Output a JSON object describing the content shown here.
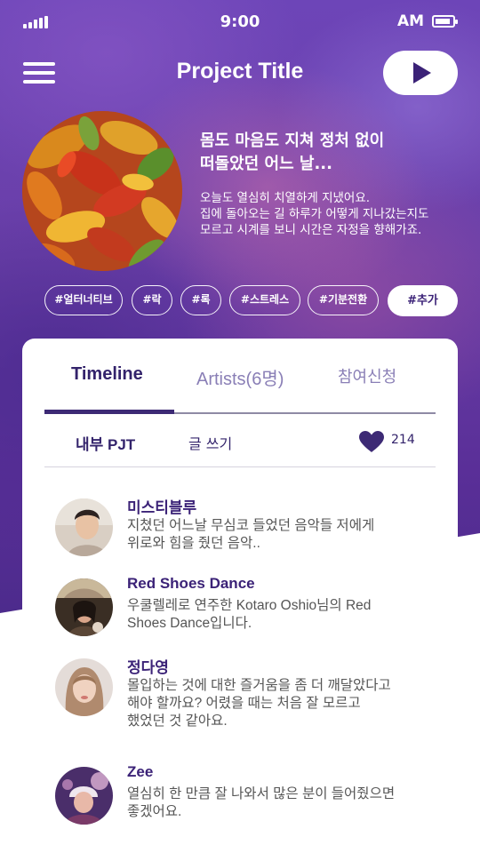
{
  "status_bar": {
    "time": "9:00",
    "ampm": "AM"
  },
  "header": {
    "title": "Project Title",
    "menu_icon": "hamburger-menu-icon",
    "play_icon": "play-icon"
  },
  "album": {
    "title_lines": [
      "몸도 마음도 지쳐 정처 없이",
      "떠돌았던 어느 날..."
    ],
    "description_lines": [
      "오늘도 열심히 치열하게 지냈어요.",
      "집에 돌아오는 길 하루가 어떻게 지나갔는지도",
      "모르고 시계를 보니 시간은 자정을 향해가죠."
    ]
  },
  "tags": {
    "items": [
      "#얼터너티브",
      "#락",
      "#록",
      "#스트레스",
      "#기분전환"
    ],
    "add_label": "#추가"
  },
  "tabs": {
    "timeline": "Timeline",
    "artists": "Artists(6명)",
    "apply": "참여신청",
    "active": "timeline"
  },
  "sub_menu": {
    "internal": "내부 PJT",
    "write": "글 쓰기",
    "likes": "214"
  },
  "feed": [
    {
      "name": "미스티블루",
      "text_lines": [
        "지쳤던 어느날 무심코 들었던 음악들 저에게",
        "위로와 힘을 줬던 음악.."
      ]
    },
    {
      "name": "Red Shoes Dance",
      "text_lines": [
        "우쿨렐레로 연주한 Kotaro Oshio님의 Red",
        "Shoes Dance입니다."
      ]
    },
    {
      "name": "정다영",
      "text_lines": [
        "몰입하는 것에 대한 즐거움을 좀 더 깨달았다고",
        "해야 할까요? 어렸을 때는 처음 잘 모르고",
        "했었던 것 같아요."
      ]
    },
    {
      "name": "Zee",
      "text_lines": [
        "열심히 한 만큼 잘 나와서 많은 분이 들어줬으면",
        "좋겠어요."
      ]
    }
  ],
  "colors": {
    "primary": "#3b2277",
    "muted_tab": "#8a7fb6",
    "background_purple": "#5a2f98"
  }
}
